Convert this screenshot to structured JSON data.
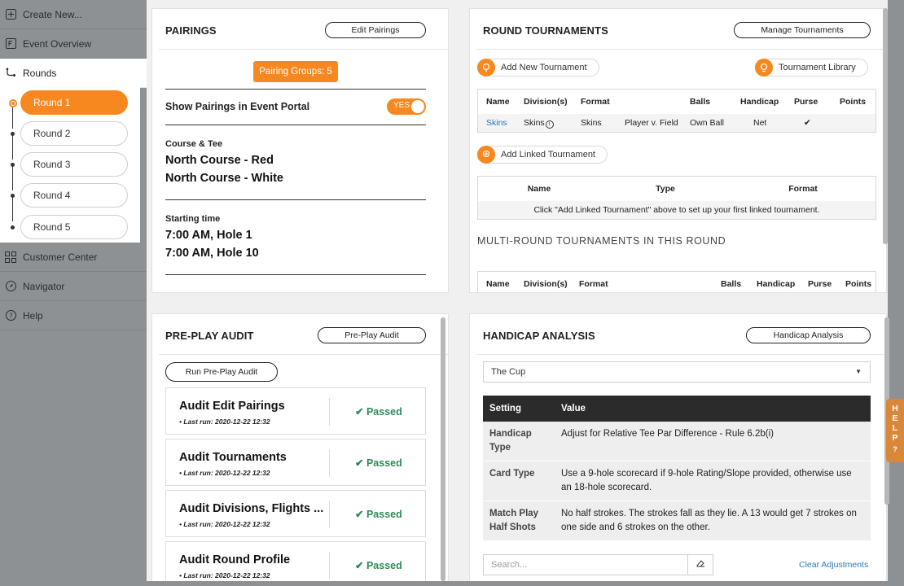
{
  "sidebar": {
    "items_top": [
      {
        "label": "Create New...",
        "icon": "plus-square-icon"
      },
      {
        "label": "Event Overview",
        "icon": "document-icon"
      },
      {
        "label": "Rounds",
        "icon": "route-icon"
      }
    ],
    "rounds": [
      "Round 1",
      "Round 2",
      "Round 3",
      "Round 4",
      "Round 5"
    ],
    "items_bottom": [
      {
        "label": "Customer Center",
        "icon": "grid-icon"
      },
      {
        "label": "Navigator",
        "icon": "compass-icon"
      },
      {
        "label": "Help",
        "icon": "question-icon"
      }
    ]
  },
  "pairings": {
    "title": "PAIRINGS",
    "edit_button": "Edit Pairings",
    "groups_chip": "Pairing Groups: 5",
    "show_label": "Show Pairings in Event Portal",
    "toggle_label": "YES",
    "course_label": "Course & Tee",
    "course_values": [
      "North Course - Red",
      "North Course - White"
    ],
    "start_label": "Starting time",
    "start_values": [
      "7:00 AM, Hole 1",
      "7:00 AM, Hole 10"
    ]
  },
  "round_tournaments": {
    "title": "ROUND TOURNAMENTS",
    "manage_button": "Manage Tournaments",
    "add_new": "Add New Tournament",
    "library": "Tournament Library",
    "columns": [
      "Name",
      "Division(s)",
      "Format",
      "",
      "Balls",
      "Handicap",
      "Purse",
      "Points"
    ],
    "row": {
      "name": "Skins",
      "division": "Skins",
      "format": "Skins",
      "format2": "Player v. Field",
      "balls": "Own Ball",
      "handicap": "Net",
      "purse": "✔",
      "points": ""
    },
    "add_linked": "Add Linked Tournament",
    "linked_columns": [
      "Name",
      "Type",
      "Format"
    ],
    "linked_empty": "Click \"Add Linked Tournament\" above to set up your first linked tournament.",
    "multi_caption": "MULTI-ROUND TOURNAMENTS IN THIS ROUND",
    "multi_columns": [
      "Name",
      "Division(s)",
      "Format",
      "Balls",
      "Handicap",
      "Purse",
      "Points"
    ]
  },
  "preplay": {
    "title": "PRE-PLAY AUDIT",
    "audit_button": "Pre-Play Audit",
    "run_button": "Run Pre-Play Audit",
    "items": [
      {
        "title": "Audit Edit Pairings",
        "sub": "• Last run: 2020-12-22 12:32",
        "status": "Passed"
      },
      {
        "title": "Audit Tournaments",
        "sub": "• Last run: 2020-12-22 12:32",
        "status": "Passed"
      },
      {
        "title": "Audit Divisions, Flights ...",
        "sub": "• Last run: 2020-12-22 12:32",
        "status": "Passed"
      },
      {
        "title": "Audit Round Profile",
        "sub": "• Last run: 2020-12-22 12:32",
        "status": "Passed"
      }
    ]
  },
  "handicap": {
    "title": "HANDICAP ANALYSIS",
    "analysis_button": "Handicap Analysis",
    "select_value": "The Cup",
    "columns": [
      "Setting",
      "Value"
    ],
    "rows": [
      {
        "k": "Handicap Type",
        "v": "Adjust for Relative Tee Par Difference - Rule 6.2b(i)"
      },
      {
        "k": "Card Type",
        "v": "Use a 9-hole scorecard if 9-hole Rating/Slope provided, otherwise use an 18-hole scorecard."
      },
      {
        "k": "Match Play Half Shots",
        "v": "No half strokes. The strokes fall as they lie. A 13 would get 7 strokes on one side and 6 strokes on the other."
      }
    ],
    "search_placeholder": "Search...",
    "clear_link": "Clear Adjustments"
  },
  "help_tab": "HELP",
  "colors": {
    "accent": "#f7871f",
    "passed": "#2e8b57",
    "link": "#2a7ab8"
  }
}
